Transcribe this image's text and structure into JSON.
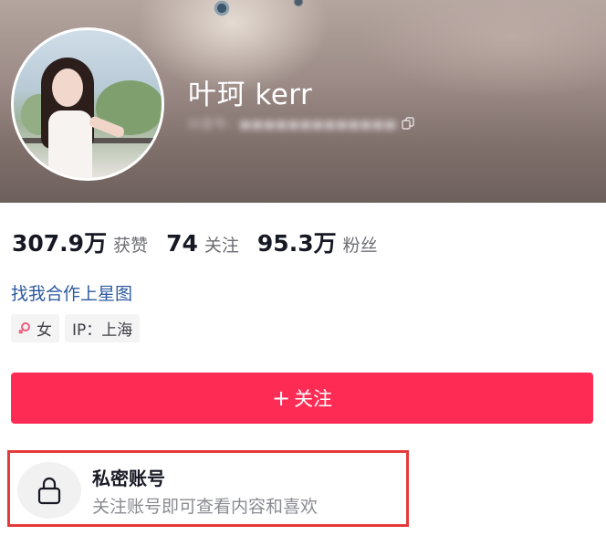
{
  "profile": {
    "username": "叶珂 kerr",
    "account_id": "抖音号：■■■■■■■■■■■■■■"
  },
  "stats": [
    {
      "value": "307.9万",
      "label": "获赞"
    },
    {
      "value": "74",
      "label": "关注"
    },
    {
      "value": "95.3万",
      "label": "粉丝"
    }
  ],
  "bio": {
    "link_text": "找我合作上星图"
  },
  "tags": {
    "gender": "女",
    "ip": "IP：上海"
  },
  "actions": {
    "follow_plus": "+",
    "follow_label": "关注"
  },
  "private_notice": {
    "title": "私密账号",
    "description": "关注账号即可查看内容和喜欢"
  },
  "icons": {
    "copy": "copy-icon",
    "female": "female-icon",
    "lock": "lock-icon"
  },
  "colors": {
    "accent": "#fe2c55",
    "link": "#2d5a9e",
    "highlight_box": "#e53a3a",
    "female": "#f35c7c"
  }
}
